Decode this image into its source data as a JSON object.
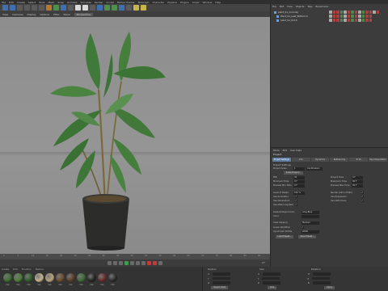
{
  "menubar": [
    "File",
    "Edit",
    "Create",
    "Select",
    "Tools",
    "Mesh",
    "Snap",
    "Animate",
    "Simulate",
    "Render",
    "Sculpt",
    "Motion Tracker",
    "MoGraph",
    "Character",
    "Pipeline",
    "Plugins",
    "Script",
    "Window",
    "Help"
  ],
  "viewport": {
    "menu": [
      "View",
      "Cameras",
      "Display",
      "Options",
      "Filter",
      "Panel"
    ],
    "camera_label": "Perspective"
  },
  "timeline": {
    "ticks": [
      "0",
      "5",
      "10",
      "15",
      "20",
      "25",
      "30",
      "35",
      "40",
      "45",
      "50",
      "55",
      "60",
      "65",
      "70",
      "75",
      "80",
      "85",
      "90"
    ],
    "frame_readout": "0 F"
  },
  "material_bar": {
    "menu": [
      "Create",
      "Edit",
      "Function",
      "Texture"
    ],
    "materials": [
      {
        "label": "Mat",
        "color": "#3c6d2f"
      },
      {
        "label": "Mat",
        "color": "#4a7d34"
      },
      {
        "label": "Mat",
        "color": "#2f5a2a"
      },
      {
        "label": "Mat",
        "color": "#c5b48c"
      },
      {
        "label": "Mat",
        "color": "#b9a37a"
      },
      {
        "label": "Mat",
        "color": "#6a4a2e"
      },
      {
        "label": "Mat",
        "color": "#5a3d26"
      },
      {
        "label": "Mat",
        "color": "#3a6a32"
      },
      {
        "label": "Mat",
        "color": "#23241f"
      },
      {
        "label": "Mat",
        "color": "#6a2a2a"
      },
      {
        "label": "Mat",
        "color": "#2b2b2b"
      }
    ]
  },
  "coords": {
    "headers": [
      "Position",
      "Size",
      "Rotation"
    ],
    "rows": [
      {
        "axis": "X",
        "size_axis": "X",
        "rot_axis": "H"
      },
      {
        "axis": "Y",
        "size_axis": "Y",
        "rot_axis": "P"
      },
      {
        "axis": "Z",
        "size_axis": "Z",
        "rot_axis": "B"
      }
    ],
    "mode_object": "Object (Rel)",
    "mode_size": "Size",
    "apply_label": "Apply"
  },
  "object_manager": {
    "menu": [
      "File",
      "Edit",
      "View",
      "Objects",
      "Tags",
      "Bookmarks"
    ],
    "objects": [
      {
        "name": "plant_01_mod.obj"
      },
      {
        "name": "Plant_01_Leaf_Bottom.0"
      },
      {
        "name": "plant_01_Pot.0"
      }
    ]
  },
  "attributes": {
    "menu": [
      "Mode",
      "Edit",
      "User Data"
    ],
    "object_label": "Project",
    "tabs": [
      "Project Settings",
      "Info",
      "Dynamics",
      "Referencing",
      "To Do",
      "Key Interpolation"
    ],
    "section": "Project Settings",
    "fields": [
      {
        "label": "Project Scale",
        "value": "1",
        "unit": "Centimeters"
      },
      {
        "label": "Scale Project...",
        "value": ""
      },
      {
        "label": "FPS",
        "value": "30"
      },
      {
        "label": "Project Time",
        "value": "0 F"
      },
      {
        "label": "Minimum Time",
        "value": "0 F"
      },
      {
        "label": "Maximum Time",
        "value": "90 F"
      },
      {
        "label": "Preview Min Time",
        "value": "0 F"
      },
      {
        "label": "Preview Max Time",
        "value": "90 F"
      },
      {
        "label": "Level of Detail",
        "value": "100 %"
      },
      {
        "label": "Render LOD in Editor",
        "value": ""
      },
      {
        "label": "Use Animation",
        "value": ""
      },
      {
        "label": "Use Expression",
        "value": ""
      },
      {
        "label": "Use Generators",
        "value": ""
      },
      {
        "label": "Use Deformers",
        "value": ""
      },
      {
        "label": "Use Motion System",
        "value": ""
      },
      {
        "label": "Default Object Color",
        "value": "Gray-Blue"
      },
      {
        "label": "Color",
        "value": ""
      },
      {
        "label": "View Clipping",
        "value": "Medium"
      },
      {
        "label": "Linear Workflow",
        "value": ""
      },
      {
        "label": "Input Color Profile",
        "value": "sRGB"
      },
      {
        "label": "Load Preset...",
        "value": ""
      },
      {
        "label": "Save Preset...",
        "value": ""
      }
    ]
  }
}
